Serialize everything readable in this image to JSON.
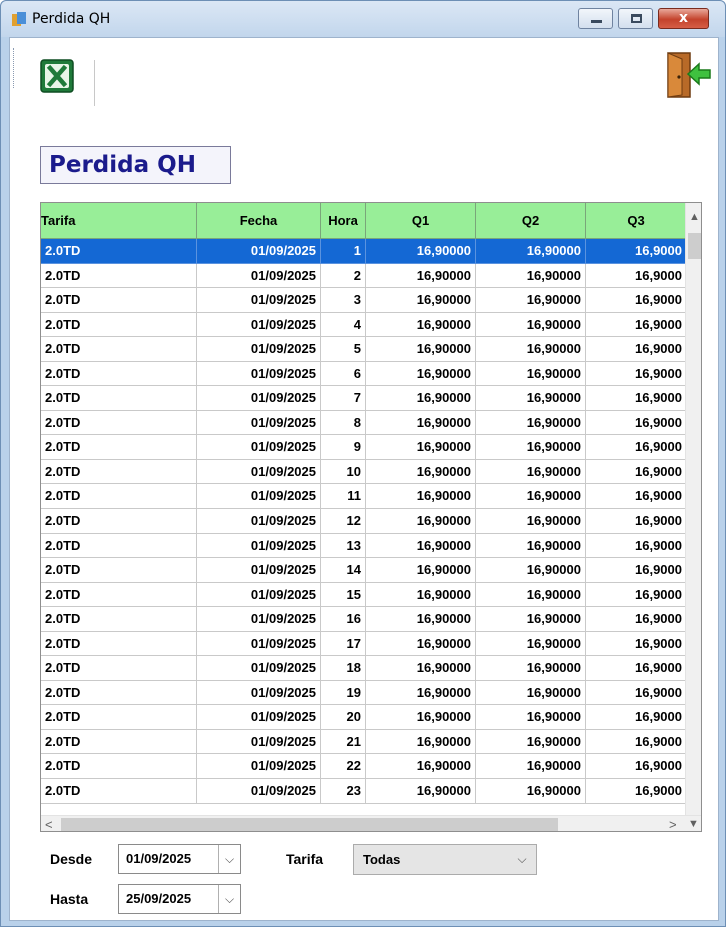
{
  "window": {
    "title": "Perdida QH",
    "close_glyph": "x"
  },
  "toolbar": {
    "excel_icon": "excel-export-icon",
    "exit_icon": "exit-door-icon"
  },
  "form": {
    "title": "Perdida QH"
  },
  "grid": {
    "columns": [
      "Tarifa",
      "Fecha",
      "Hora",
      "Q1",
      "Q2",
      "Q3"
    ],
    "selected_row": 1,
    "rows": [
      {
        "tarifa": "2.0TD",
        "fecha": "01/09/2025",
        "hora": "1",
        "q1": "16,90000",
        "q2": "16,90000",
        "q3": "16,9000"
      },
      {
        "tarifa": "2.0TD",
        "fecha": "01/09/2025",
        "hora": "2",
        "q1": "16,90000",
        "q2": "16,90000",
        "q3": "16,9000"
      },
      {
        "tarifa": "2.0TD",
        "fecha": "01/09/2025",
        "hora": "3",
        "q1": "16,90000",
        "q2": "16,90000",
        "q3": "16,9000"
      },
      {
        "tarifa": "2.0TD",
        "fecha": "01/09/2025",
        "hora": "4",
        "q1": "16,90000",
        "q2": "16,90000",
        "q3": "16,9000"
      },
      {
        "tarifa": "2.0TD",
        "fecha": "01/09/2025",
        "hora": "5",
        "q1": "16,90000",
        "q2": "16,90000",
        "q3": "16,9000"
      },
      {
        "tarifa": "2.0TD",
        "fecha": "01/09/2025",
        "hora": "6",
        "q1": "16,90000",
        "q2": "16,90000",
        "q3": "16,9000"
      },
      {
        "tarifa": "2.0TD",
        "fecha": "01/09/2025",
        "hora": "7",
        "q1": "16,90000",
        "q2": "16,90000",
        "q3": "16,9000"
      },
      {
        "tarifa": "2.0TD",
        "fecha": "01/09/2025",
        "hora": "8",
        "q1": "16,90000",
        "q2": "16,90000",
        "q3": "16,9000"
      },
      {
        "tarifa": "2.0TD",
        "fecha": "01/09/2025",
        "hora": "9",
        "q1": "16,90000",
        "q2": "16,90000",
        "q3": "16,9000"
      },
      {
        "tarifa": "2.0TD",
        "fecha": "01/09/2025",
        "hora": "10",
        "q1": "16,90000",
        "q2": "16,90000",
        "q3": "16,9000"
      },
      {
        "tarifa": "2.0TD",
        "fecha": "01/09/2025",
        "hora": "11",
        "q1": "16,90000",
        "q2": "16,90000",
        "q3": "16,9000"
      },
      {
        "tarifa": "2.0TD",
        "fecha": "01/09/2025",
        "hora": "12",
        "q1": "16,90000",
        "q2": "16,90000",
        "q3": "16,9000"
      },
      {
        "tarifa": "2.0TD",
        "fecha": "01/09/2025",
        "hora": "13",
        "q1": "16,90000",
        "q2": "16,90000",
        "q3": "16,9000"
      },
      {
        "tarifa": "2.0TD",
        "fecha": "01/09/2025",
        "hora": "14",
        "q1": "16,90000",
        "q2": "16,90000",
        "q3": "16,9000"
      },
      {
        "tarifa": "2.0TD",
        "fecha": "01/09/2025",
        "hora": "15",
        "q1": "16,90000",
        "q2": "16,90000",
        "q3": "16,9000"
      },
      {
        "tarifa": "2.0TD",
        "fecha": "01/09/2025",
        "hora": "16",
        "q1": "16,90000",
        "q2": "16,90000",
        "q3": "16,9000"
      },
      {
        "tarifa": "2.0TD",
        "fecha": "01/09/2025",
        "hora": "17",
        "q1": "16,90000",
        "q2": "16,90000",
        "q3": "16,9000"
      },
      {
        "tarifa": "2.0TD",
        "fecha": "01/09/2025",
        "hora": "18",
        "q1": "16,90000",
        "q2": "16,90000",
        "q3": "16,9000"
      },
      {
        "tarifa": "2.0TD",
        "fecha": "01/09/2025",
        "hora": "19",
        "q1": "16,90000",
        "q2": "16,90000",
        "q3": "16,9000"
      },
      {
        "tarifa": "2.0TD",
        "fecha": "01/09/2025",
        "hora": "20",
        "q1": "16,90000",
        "q2": "16,90000",
        "q3": "16,9000"
      },
      {
        "tarifa": "2.0TD",
        "fecha": "01/09/2025",
        "hora": "21",
        "q1": "16,90000",
        "q2": "16,90000",
        "q3": "16,9000"
      },
      {
        "tarifa": "2.0TD",
        "fecha": "01/09/2025",
        "hora": "22",
        "q1": "16,90000",
        "q2": "16,90000",
        "q3": "16,9000"
      },
      {
        "tarifa": "2.0TD",
        "fecha": "01/09/2025",
        "hora": "23",
        "q1": "16,90000",
        "q2": "16,90000",
        "q3": "16,9000"
      }
    ]
  },
  "filters": {
    "desde_label": "Desde",
    "desde_value": "01/09/2025",
    "hasta_label": "Hasta",
    "hasta_value": "25/09/2025",
    "tarifa_label": "Tarifa",
    "tarifa_value": "Todas"
  },
  "colors": {
    "header_bg": "#98ee98",
    "selection": "#1468d4",
    "title_text": "#1b1b8c"
  }
}
